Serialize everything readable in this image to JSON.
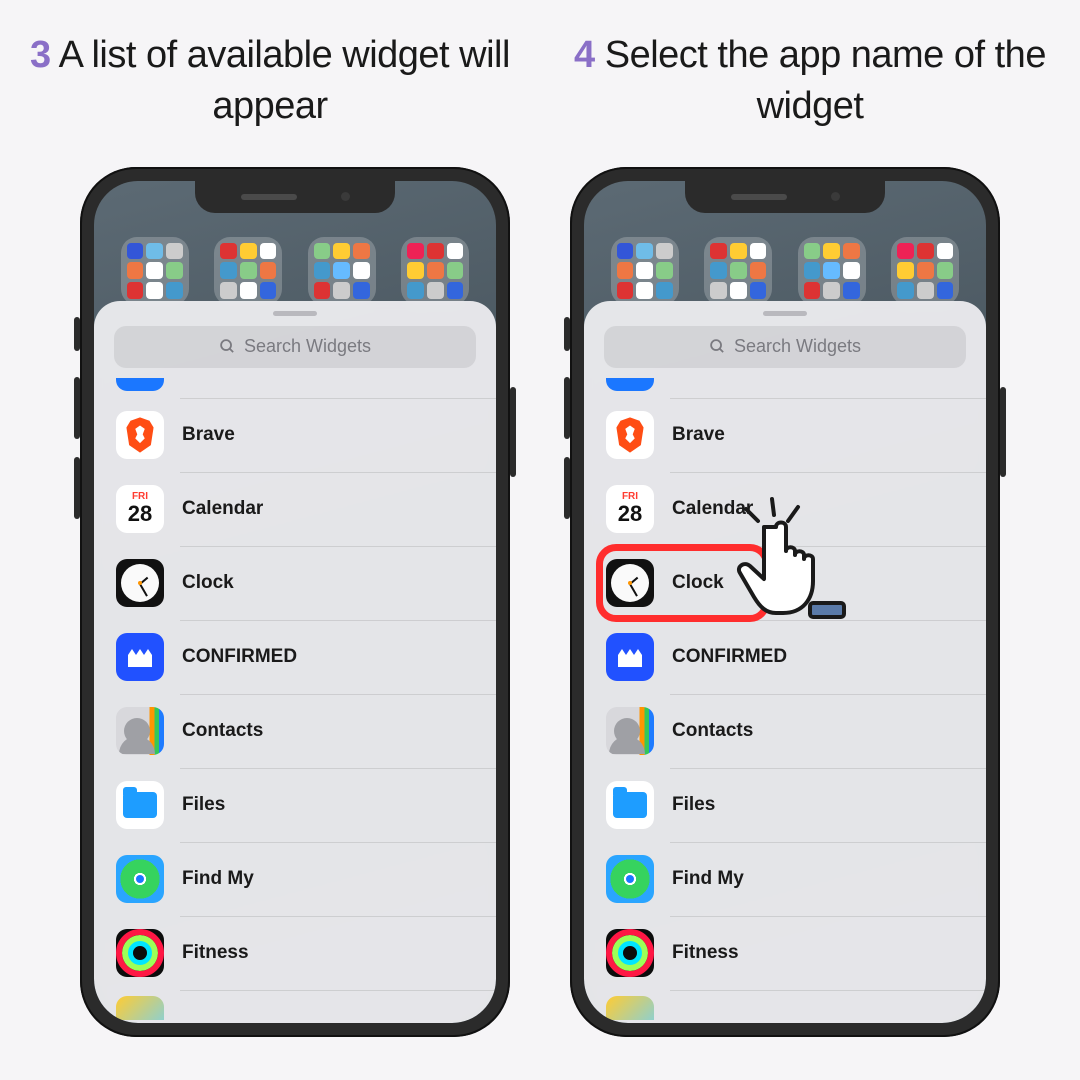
{
  "steps": [
    {
      "num": "3",
      "text": "A list of available widget will appear"
    },
    {
      "num": "4",
      "text": "Select the app name of the widget"
    }
  ],
  "search_placeholder": "Search Widgets",
  "calendar": {
    "dow": "FRI",
    "day": "28"
  },
  "apps": {
    "brave": "Brave",
    "calendar": "Calendar",
    "clock": "Clock",
    "confirmed": "CONFIRMED",
    "contacts": "Contacts",
    "files": "Files",
    "findmy": "Find My",
    "fitness": "Fitness"
  },
  "highlighted_app": "clock"
}
